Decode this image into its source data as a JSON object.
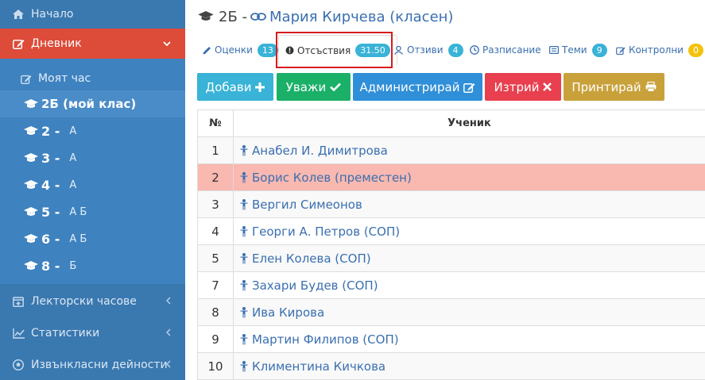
{
  "sidebar": {
    "home_label": "Начало",
    "diary_label": "Дневник",
    "my_hour_label": "Моят час",
    "my_class_label": "2Б (мой клас)",
    "classes": [
      {
        "grade": "2 -",
        "letters": "А"
      },
      {
        "grade": "3 -",
        "letters": "А"
      },
      {
        "grade": "4 -",
        "letters": "А"
      },
      {
        "grade": "5 -",
        "letters": "А Б"
      },
      {
        "grade": "6 -",
        "letters": "А Б"
      },
      {
        "grade": "8 -",
        "letters": "Б"
      }
    ],
    "lecture_hours_label": "Лекторски часове",
    "statistics_label": "Статистики",
    "extracurricular_label": "Извънкласни дейности"
  },
  "header": {
    "class_prefix": "2Б -",
    "teacher_name": "Мария Кирчева (класен)"
  },
  "tabs": [
    {
      "label": "Оценки",
      "badge": "13"
    },
    {
      "label": "Отсъствия",
      "badge": "31.50"
    },
    {
      "label": "Отзиви",
      "badge": "4"
    },
    {
      "label": "Разписание",
      "badge": ""
    },
    {
      "label": "Теми",
      "badge": "9"
    },
    {
      "label": "Контролни",
      "badge": "0"
    }
  ],
  "toolbar": {
    "add_label": "Добави",
    "excuse_label": "Уважи",
    "admin_label": "Администрирай",
    "delete_label": "Изтрий",
    "print_label": "Принтирай"
  },
  "table": {
    "col_num": "№",
    "col_student": "Ученик",
    "rows": [
      {
        "num": "1",
        "name": "Анабел И. Димитрова"
      },
      {
        "num": "2",
        "name": "Борис Колев (преместен)"
      },
      {
        "num": "3",
        "name": "Вергил Симеонов"
      },
      {
        "num": "4",
        "name": "Георги А. Петров (СОП)"
      },
      {
        "num": "5",
        "name": "Елен Колева (СОП)"
      },
      {
        "num": "7",
        "name": "Захари Будев (СОП)"
      },
      {
        "num": "8",
        "name": "Ива Кирова"
      },
      {
        "num": "9",
        "name": "Мартин Филипов (СОП)"
      },
      {
        "num": "10",
        "name": "Климентина Кичкова"
      }
    ]
  },
  "colors": {
    "sidebar": "#3a78b0",
    "active": "#dd4b39",
    "highlight_border": "#d61c1c",
    "danger_row": "#f9b8b0"
  }
}
